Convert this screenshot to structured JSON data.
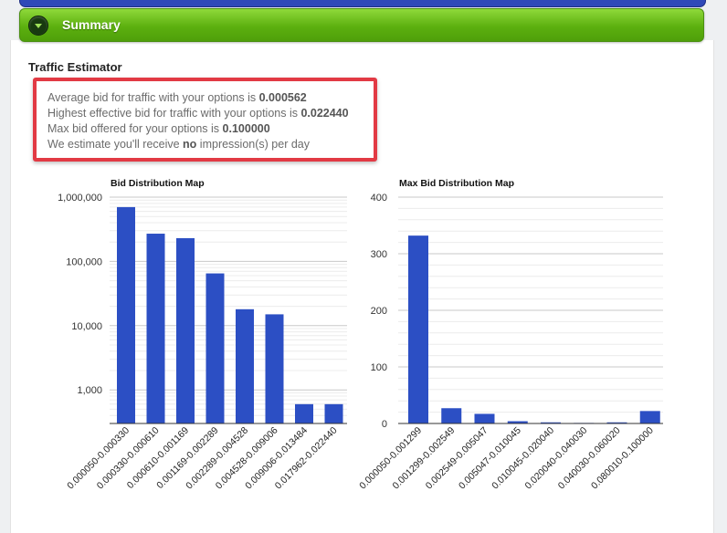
{
  "header": {
    "summary_label": "Summary"
  },
  "section": {
    "title": "Traffic Estimator"
  },
  "estimates": {
    "line1_prefix": "Average bid for traffic with your options is ",
    "line1_value": "0.000562",
    "line2_prefix": "Highest effective bid for traffic with your options is ",
    "line2_value": "0.022440",
    "line3_prefix": "Max bid offered for your options is ",
    "line3_value": "0.100000",
    "line4_prefix": "We estimate you'll receive ",
    "line4_value": "no",
    "line4_suffix": " impression(s) per day"
  },
  "colors": {
    "bar": "#2c4fc4",
    "summary_bar": "#5cb00f",
    "highlight_border": "#e23a44"
  },
  "chart_data": [
    {
      "type": "bar",
      "title": "Bid Distribution Map",
      "yscale": "log",
      "ylim": [
        300,
        1000000
      ],
      "yticks": [
        1000,
        10000,
        100000,
        1000000
      ],
      "ytick_labels": [
        "1,000",
        "10,000",
        "100,000",
        "1,000,000"
      ],
      "grid": true,
      "categories": [
        "0.000050-0.000330",
        "0.000330-0.000610",
        "0.000610-0.001169",
        "0.001169-0.002289",
        "0.002289-0.004528",
        "0.004528-0.009006",
        "0.009006-0.013484",
        "0.017962-0.022440"
      ],
      "values": [
        700000,
        270000,
        230000,
        65000,
        18000,
        15000,
        600,
        600
      ]
    },
    {
      "type": "bar",
      "title": "Max Bid Distribution Map",
      "yscale": "linear",
      "ylim": [
        0,
        400
      ],
      "yticks": [
        0,
        100,
        200,
        300,
        400
      ],
      "ytick_labels": [
        "0",
        "100",
        "200",
        "300",
        "400"
      ],
      "grid": true,
      "categories": [
        "0.000050-0.001299",
        "0.001299-0.002549",
        "0.002549-0.005047",
        "0.005047-0.010045",
        "0.010045-0.020040",
        "0.020040-0.040030",
        "0.040030-0.060020",
        "0.080010-0.100000"
      ],
      "values": [
        332,
        27,
        17,
        4,
        2,
        1,
        2,
        22
      ]
    }
  ]
}
